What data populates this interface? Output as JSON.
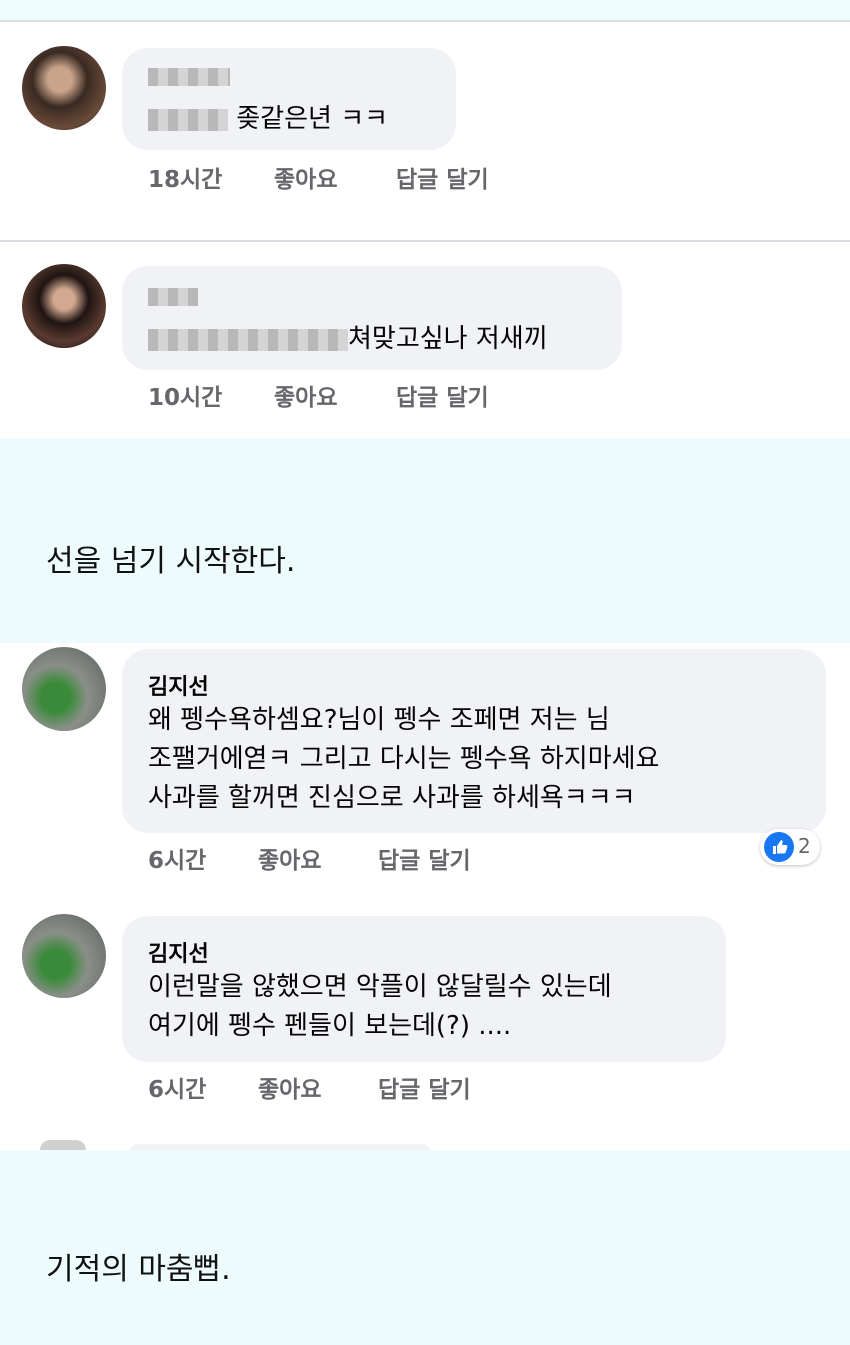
{
  "comments": [
    {
      "text": "좆같은년 ㅋㅋ",
      "time": "18시간",
      "like": "좋아요",
      "reply": "답글 달기"
    },
    {
      "text": "쳐맞고싶나 저새끼",
      "time": "10시간",
      "like": "좋아요",
      "reply": "답글 달기"
    },
    {
      "author": "김지선",
      "lines": [
        "왜 펭수욕하셈요?님이 펭수 조페면 저는 님",
        "조팰거에엳ㅋ 그리고 다시는 펭수욕 하지마세요",
        "사과를 할꺼면 진심으로 사과를 하세욕ㅋㅋㅋ"
      ],
      "time": "6시간",
      "like": "좋아요",
      "reply": "답글 달기",
      "reaction_count": "2"
    },
    {
      "author": "김지선",
      "lines": [
        "이런말을 않했으면 악플이 않달릴수 있는데",
        "여기에 펭수 펜들이 보는데(?) ...."
      ],
      "time": "6시간",
      "like": "좋아요",
      "reply": "답글 달기"
    }
  ],
  "captions": [
    "선을 넘기 시작한다.",
    "기적의 마춤뻡."
  ],
  "icons": {
    "reaction": "like-thumb-icon"
  },
  "colors": {
    "accent": "#1877f2",
    "bubble": "#f0f2f5",
    "meta": "#65676b",
    "caption_bg": "#eefbfc"
  }
}
